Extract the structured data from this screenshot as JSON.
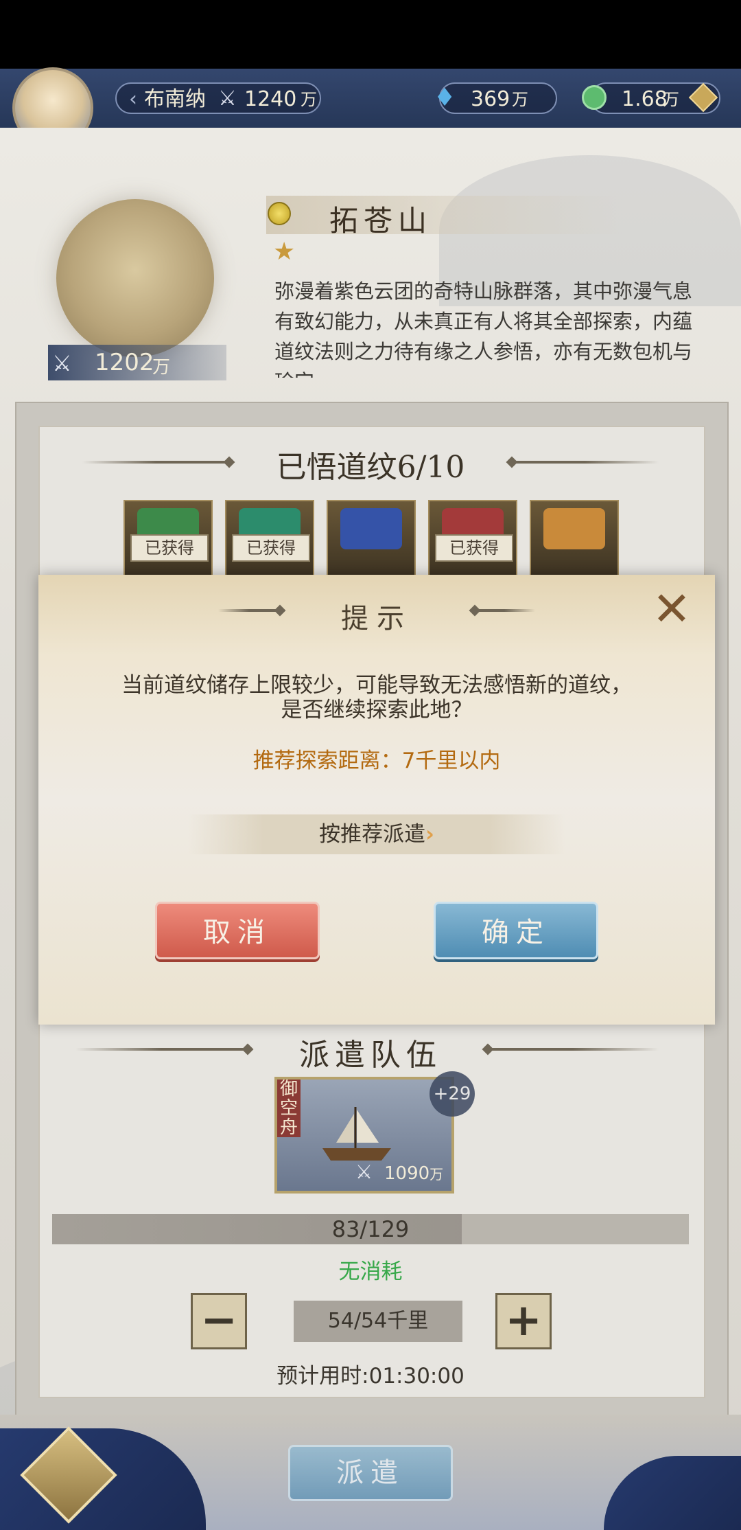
{
  "header": {
    "player_name": "布南纳",
    "power": "1240",
    "power_unit": "万",
    "crystal": "369",
    "crystal_unit": "万",
    "jade": "1.68",
    "jade_unit": "万",
    "add_icon": "plus-diamond-icon"
  },
  "location": {
    "name": "拓苍山",
    "description": "弥漫着紫色云团的奇特山脉群落，其中弥漫气息有致幻能力，从未真正有人将其全部探索，内蕴道纹法则之力待有缘之人参悟，亦有无数包机与珍宝",
    "power": "1202",
    "power_unit": "万"
  },
  "daowen": {
    "title": "已悟道纹6/10",
    "items": [
      {
        "label": "已获得",
        "color": "#3d8a4a"
      },
      {
        "label": "已获得",
        "color": "#2c8c6c"
      },
      {
        "label": "",
        "color": "#3553a8"
      },
      {
        "label": "已获得",
        "color": "#a33a3a"
      },
      {
        "label": "",
        "color": "#c98a3a"
      }
    ]
  },
  "dialog": {
    "title": "提示",
    "message_line1": "当前道纹储存上限较少，可能导致无法感悟新的道纹，",
    "message_line2": "是否继续探索此地？",
    "recommend": "推荐探索距离：7千里以内",
    "dispatch_recommend": "按推荐派遣",
    "cancel": "取消",
    "confirm": "确定"
  },
  "team": {
    "title": "派遣队伍",
    "ship_tag": "御空舟",
    "ship_plus": "+29",
    "ship_power": "1090",
    "ship_power_unit": "万",
    "capacity": "83/129",
    "capacity_fraction": 0.643,
    "cost": "无消耗",
    "distance": "54/54千里",
    "eta": "预计用时:01:30:00"
  },
  "bottom": {
    "dispatch": "派遣"
  }
}
